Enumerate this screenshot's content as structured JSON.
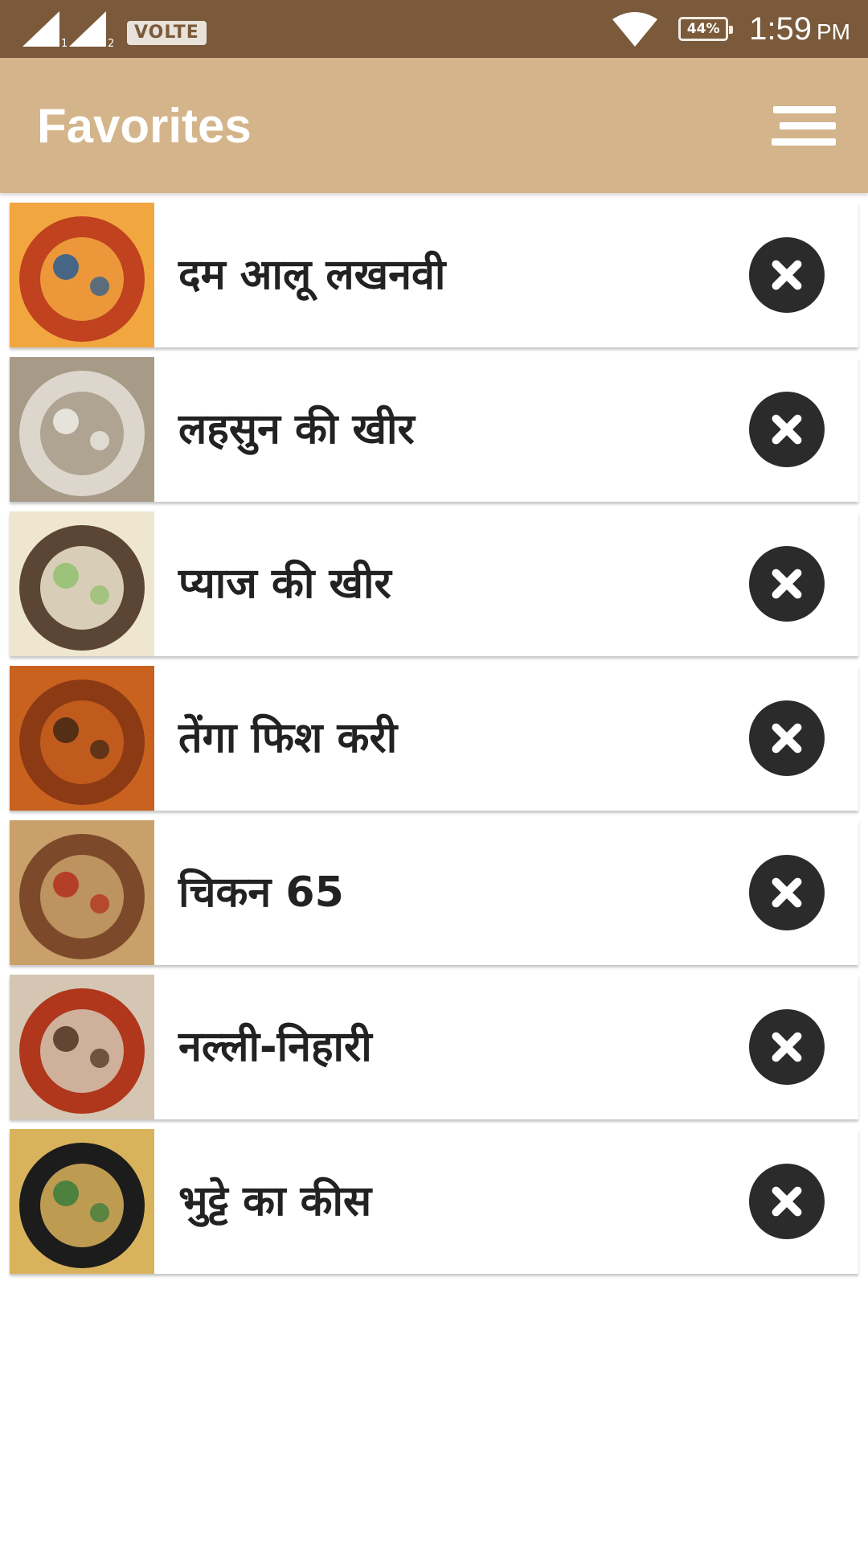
{
  "status_bar": {
    "sim1": "1",
    "sim2": "2",
    "volte": "VOLTE",
    "battery": "44%",
    "time": "1:59",
    "ampm": "PM"
  },
  "app_bar": {
    "title": "Favorites",
    "sort_icon": "sort-icon"
  },
  "favorites": [
    {
      "title": "दम आलू लखनवी",
      "thumb_colors": [
        "#c0421e",
        "#f2a640",
        "#1e5a9a"
      ]
    },
    {
      "title": "लहसुन की खीर",
      "thumb_colors": [
        "#dcd6cc",
        "#a79a87",
        "#f4f2ee"
      ]
    },
    {
      "title": "प्याज की खीर",
      "thumb_colors": [
        "#5b4535",
        "#efe6cf",
        "#8fbf6a"
      ]
    },
    {
      "title": "तेंगा फिश करी",
      "thumb_colors": [
        "#8b3a14",
        "#c9621f",
        "#3a2315"
      ]
    },
    {
      "title": "चिकन 65",
      "thumb_colors": [
        "#7c4a2a",
        "#c9a06a",
        "#b22a1a"
      ]
    },
    {
      "title": "नल्ली-निहारी",
      "thumb_colors": [
        "#b0361c",
        "#d4c6b2",
        "#4a2a1a"
      ]
    },
    {
      "title": "भुट्टे का कीस",
      "thumb_colors": [
        "#1c1c1c",
        "#d9b35c",
        "#2f7a3a"
      ]
    }
  ],
  "colors": {
    "status_bar": "#7a5a3a",
    "app_bar": "#d4b48a",
    "remove_button": "#2b2b2b"
  }
}
